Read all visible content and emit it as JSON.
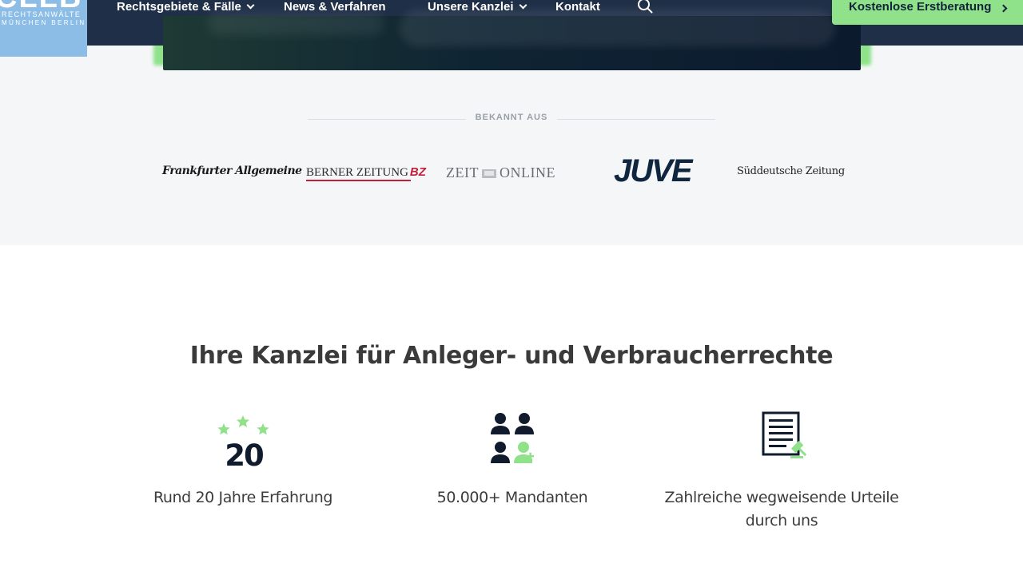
{
  "header": {
    "logo": {
      "word": "CLLB",
      "line1": "RECHTSANWÄLTE",
      "line2": "MÜNCHEN  BERLIN",
      "bg_color": "#8bbde6"
    },
    "nav": [
      {
        "label": "Rechtsgebiete & Fälle",
        "has_dropdown": true
      },
      {
        "label": "News & Verfahren",
        "has_dropdown": false
      },
      {
        "label": "Unsere Kanzlei",
        "has_dropdown": true
      },
      {
        "label": "Kontakt",
        "has_dropdown": false
      }
    ],
    "search_icon": "search-icon",
    "cta_label": "Kostenlose Erstberatung",
    "bg_color": "#1f2f47",
    "accent_color": "#8fe28a"
  },
  "press": {
    "title": "BEKANNT AUS",
    "logos": {
      "faz": "Frankfurter Allgemeine",
      "berner_main": "BERNER ZEITUNG",
      "berner_bz": "BZ",
      "zeit_left": "ZEIT",
      "zeit_right": "ONLINE",
      "juve": "JUVE",
      "sz": "Süddeutsche Zeitung"
    }
  },
  "main": {
    "title": "Ihre Kanzlei für Anleger- und Verbraucherrechte",
    "features": [
      {
        "icon": "stars-20-icon",
        "badge": "20",
        "label": "Rund 20 Jahre Erfahrung"
      },
      {
        "icon": "clients-icon",
        "label": "50.000+ Mandanten"
      },
      {
        "icon": "document-gavel-icon",
        "label_line1": "Zahlreiche wegweisende Urteile",
        "label_line2": "durch uns"
      }
    ]
  }
}
